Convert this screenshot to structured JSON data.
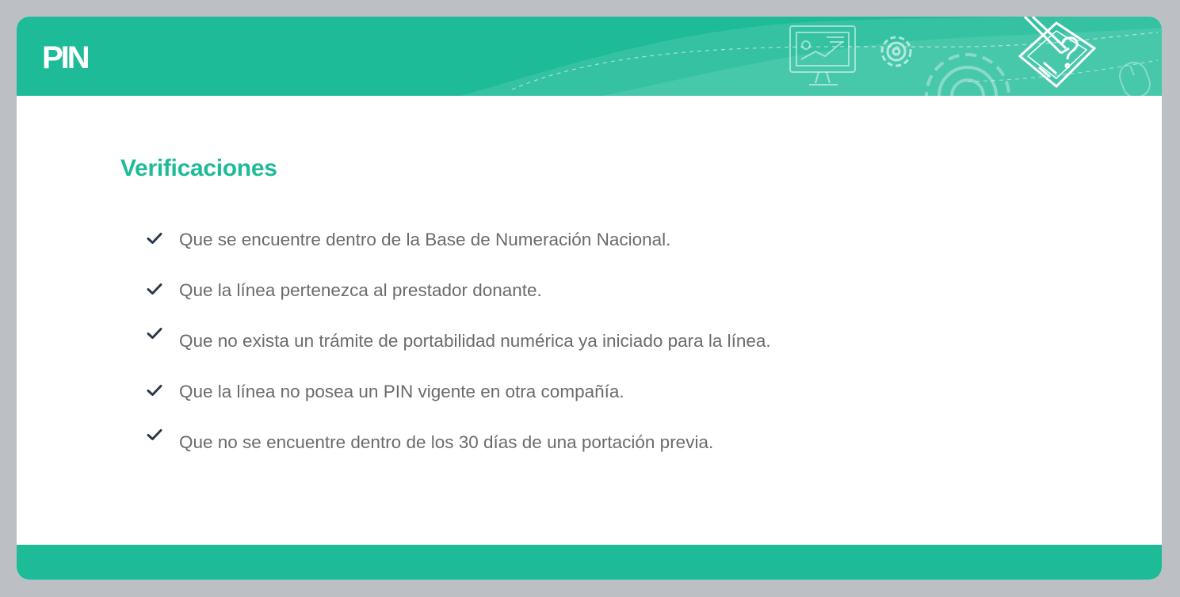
{
  "header": {
    "brand": "PIN",
    "icons": [
      "presentation-screen-icon",
      "gear-icon",
      "large-gear-icon",
      "pencil-question-icon",
      "mouse-icon"
    ]
  },
  "content": {
    "title": "Verificaciones",
    "items": [
      {
        "icon": "checkmark-icon",
        "text": "Que se encuentre dentro de la Base de Numeración Nacional."
      },
      {
        "icon": "checkmark-icon",
        "text": "Que la línea pertenezca al prestador donante."
      },
      {
        "icon": "checkmark-icon",
        "text": "Que no exista un trámite de portabilidad numérica ya iniciado para la línea."
      },
      {
        "icon": "checkmark-icon",
        "text": "Que la línea no posea un PIN vigente en otra compañía."
      },
      {
        "icon": "checkmark-icon",
        "text": "Que no se encuentre dentro de los 30 días de una portación previa."
      }
    ]
  },
  "colors": {
    "accent": "#1dbb98",
    "text": "#6b6b6b",
    "check": "#2b3a4a",
    "page_background": "#bcc0c4",
    "card": "#ffffff"
  }
}
